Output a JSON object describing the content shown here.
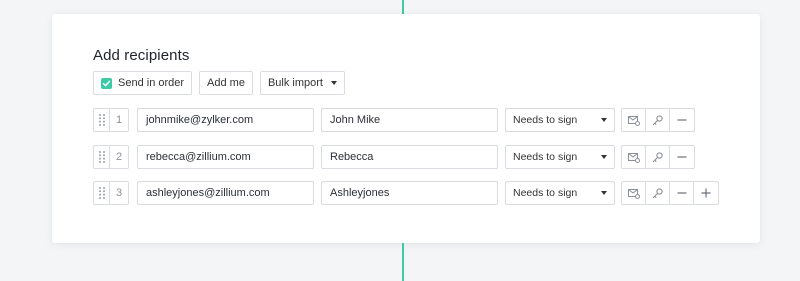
{
  "section_title": "Add recipients",
  "toolbar": {
    "send_in_order_label": "Send in order",
    "send_in_order_checked": true,
    "add_me_label": "Add me",
    "bulk_import_label": "Bulk import"
  },
  "recipients": [
    {
      "order": "1",
      "email": "johnmike@zylker.com",
      "name": "John Mike",
      "role": "Needs to sign"
    },
    {
      "order": "2",
      "email": "rebecca@zillium.com",
      "name": "Rebecca",
      "role": "Needs to sign"
    },
    {
      "order": "3",
      "email": "ashleyjones@zillium.com",
      "name": "Ashleyjones",
      "role": "Needs to sign"
    }
  ],
  "icons": {
    "drag": "drag-handle-icon",
    "mail_settings": "mail-settings-icon",
    "key": "key-icon",
    "remove": "minus-icon",
    "add": "plus-icon"
  },
  "colors": {
    "accent": "#3ec9a7",
    "border": "#d9dce1"
  }
}
